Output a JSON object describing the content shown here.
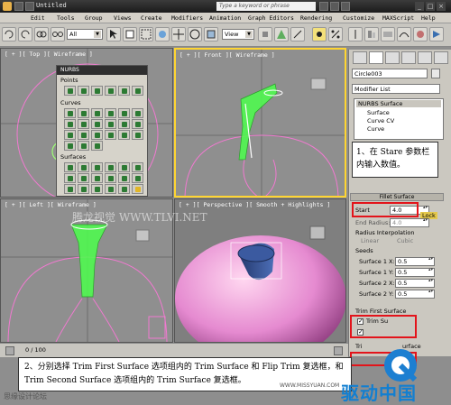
{
  "titlebar": {
    "title": "Untitled",
    "search_placeholder": "Type a keyword or phrase"
  },
  "menu": [
    "Edit",
    "Tools",
    "Group",
    "Views",
    "Create",
    "Modifiers",
    "Animation",
    "Graph Editors",
    "Rendering",
    "Customize",
    "MAXScript",
    "Help"
  ],
  "toolbar": {
    "selection_filter": "All",
    "ref_coord": "View"
  },
  "viewports": {
    "top": "[ + ][ Top ][ Wireframe ]",
    "front": "[ + ][ Front ][ Wireframe ]",
    "left": "[ + ][ Left ][ Wireframe ]",
    "perspective": "[ + ][ Perspective ][ Smooth + Highlights ]"
  },
  "nurbs_toolbox": {
    "header": "NURBS",
    "points_label": "Points",
    "curves_label": "Curves",
    "surfaces_label": "Surfaces"
  },
  "command_panel": {
    "object_name": "Circle003",
    "modifier_list": "Modifier List",
    "stack": [
      "NURBS Surface",
      "Surface",
      "Curve CV",
      "Curve"
    ],
    "rollout_title": "Fillet Surface",
    "start_label": "Start",
    "start_value": "4.0",
    "lock_label": "Lock",
    "end_radius_label": "End Radius:",
    "end_radius_value": "4.0",
    "radius_interp_label": "Radius Interpolation",
    "linear_label": "Linear",
    "cubic_label": "Cubic",
    "seeds_label": "Seeds",
    "seeds": [
      {
        "label": "Surface 1 X:",
        "value": "0.5"
      },
      {
        "label": "Surface 1 Y:",
        "value": "0.5"
      },
      {
        "label": "Surface 2 X:",
        "value": "0.5"
      },
      {
        "label": "Surface 2 Y:",
        "value": "0.5"
      }
    ],
    "trim_first_label": "Trim First Surface",
    "trim_surface_label": "Trim Su",
    "trim_second_label": "Tri",
    "trim_second_suffix": "urface"
  },
  "status": {
    "frame": "0 / 100"
  },
  "callouts": {
    "step1": "1、在 Stare 参数栏内输入数值。",
    "step2": "2、分别选择 Trim First Surface 选项组内的 Trim Surface 和 Flip Trim 复选框，和 Trim Second Surface 选项组内的 Trim Surface 复选框。"
  },
  "watermarks": {
    "main": "腾龙视觉 WWW.TLVI.NET",
    "missyuan": "WWW.MISSYUAN.COM",
    "forum": "思缘设计论坛",
    "brand": "驱动中国"
  }
}
